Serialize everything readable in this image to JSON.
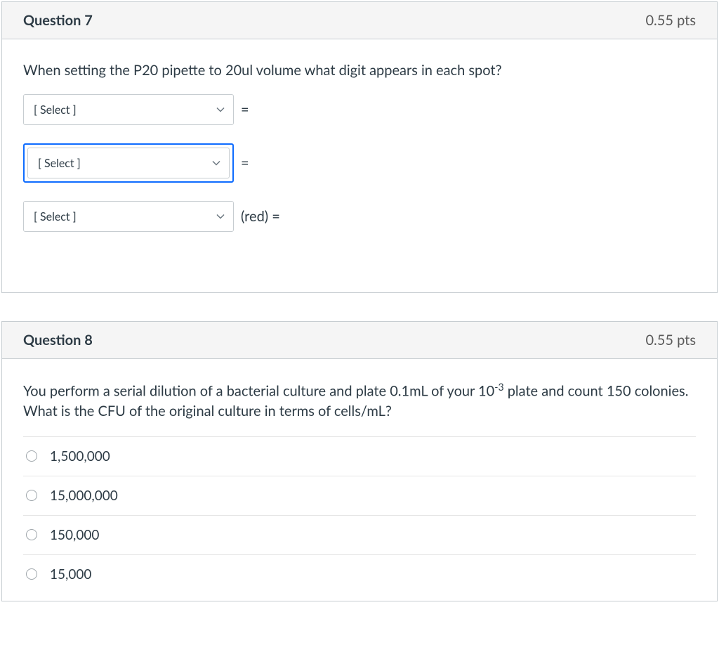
{
  "questions": [
    {
      "title": "Question 7",
      "points": "0.55 pts",
      "prompt": "When setting the P20 pipette to 20ul volume what digit appears in each spot?",
      "selects": [
        {
          "placeholder": "[ Select ]",
          "after": "=",
          "focused": false
        },
        {
          "placeholder": "[ Select ]",
          "after": "=",
          "focused": true
        },
        {
          "placeholder": "[ Select ]",
          "after": "(red) =",
          "focused": false
        }
      ]
    },
    {
      "title": "Question 8",
      "points": "0.55 pts",
      "prompt_prefix": "You perform a serial dilution of a bacterial culture and plate 0.1mL of your 10",
      "prompt_exp": "-3",
      "prompt_suffix": " plate and count 150 colonies.  What is the CFU of the original culture in terms of cells/mL?",
      "options": [
        "1,500,000",
        "15,000,000",
        "150,000",
        "15,000"
      ]
    }
  ]
}
